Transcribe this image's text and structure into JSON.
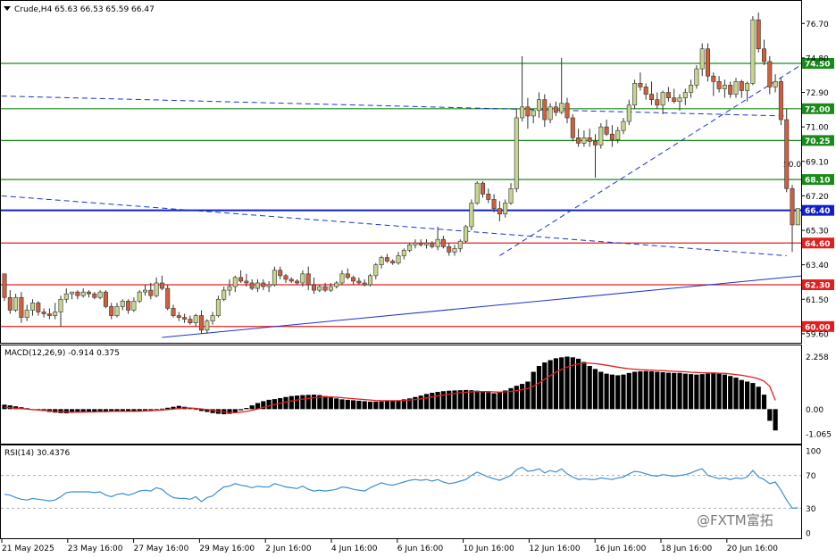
{
  "header": {
    "symbol_line": "Crude,H4  65.63 66.53 65.59 66.47",
    "macd_line": "MACD(12,26,9) -0.914 0.375",
    "rsi_line": "RSI(14) 30.4376"
  },
  "watermark": "@FXTM富拓",
  "colors": {
    "bull": "#c8d58c",
    "bear": "#d0603c",
    "resistance": "#1a8a1a",
    "support": "#e02020",
    "pivot": "#1020c8",
    "trend": "#1a33d0",
    "macd_signal": "#e02020",
    "rsi": "#3b8fd6"
  },
  "chart_data": [
    {
      "type": "candlestick",
      "name": "price",
      "y_ticks": [
        "76.70",
        "74.80",
        "72.90",
        "71.00",
        "69.10",
        "67.20",
        "65.30",
        "63.40",
        "61.50",
        "59.60"
      ],
      "ylim": [
        59.3,
        77.5
      ],
      "x_labels": [
        "21 May 2025",
        "23 May 16:00",
        "27 May 16:00",
        "29 May 16:00",
        "2 Jun 16:00",
        "4 Jun 16:00",
        "6 Jun 16:00",
        "10 Jun 16:00",
        "12 Jun 16:00",
        "16 Jun 16:00",
        "18 Jun 16:00",
        "20 Jun 16:00"
      ],
      "levels": [
        {
          "value": 74.5,
          "label": "74.50",
          "kind": "resistance"
        },
        {
          "value": 72.0,
          "label": "72.00",
          "kind": "resistance"
        },
        {
          "value": 70.25,
          "label": "70.25",
          "kind": "resistance"
        },
        {
          "value": 68.1,
          "label": "68.10",
          "kind": "resistance"
        },
        {
          "value": 66.4,
          "label": "66.40",
          "kind": "pivot"
        },
        {
          "value": 64.6,
          "label": "64.60",
          "kind": "support"
        },
        {
          "value": 62.3,
          "label": "62.30",
          "kind": "support"
        },
        {
          "value": 60.0,
          "label": "60.00",
          "kind": "support"
        }
      ],
      "fib_label": "50.0",
      "candles": [
        [
          62.9,
          62.6,
          61.4,
          61.6
        ],
        [
          61.6,
          62.0,
          60.7,
          60.9
        ],
        [
          60.9,
          61.8,
          60.8,
          61.6
        ],
        [
          61.6,
          61.9,
          60.2,
          60.5
        ],
        [
          60.5,
          61.2,
          60.3,
          60.9
        ],
        [
          60.9,
          61.5,
          60.6,
          61.3
        ],
        [
          61.3,
          61.4,
          60.6,
          60.8
        ],
        [
          60.8,
          61.0,
          60.5,
          60.7
        ],
        [
          60.7,
          61.0,
          60.4,
          60.6
        ],
        [
          60.6,
          61.3,
          60.4,
          60.8
        ],
        [
          60.8,
          61.7,
          60.0,
          61.5
        ],
        [
          61.5,
          62.1,
          61.3,
          61.8
        ],
        [
          61.8,
          61.9,
          61.5,
          61.9
        ],
        [
          61.9,
          62.0,
          61.5,
          61.7
        ],
        [
          61.7,
          62.1,
          61.6,
          61.9
        ],
        [
          61.9,
          62.0,
          61.6,
          61.8
        ],
        [
          61.8,
          61.9,
          61.5,
          61.6
        ],
        [
          61.6,
          62.0,
          61.5,
          61.9
        ],
        [
          61.9,
          62.0,
          61.0,
          61.1
        ],
        [
          61.1,
          61.3,
          60.4,
          60.6
        ],
        [
          60.6,
          61.3,
          60.5,
          61.1
        ],
        [
          61.1,
          61.5,
          60.9,
          61.4
        ],
        [
          61.4,
          61.5,
          60.7,
          60.9
        ],
        [
          60.9,
          61.6,
          60.8,
          61.4
        ],
        [
          61.4,
          62.0,
          61.3,
          61.9
        ],
        [
          61.9,
          62.3,
          61.7,
          62.0
        ],
        [
          62.0,
          62.4,
          61.5,
          61.7
        ],
        [
          61.7,
          62.7,
          61.6,
          62.4
        ],
        [
          62.4,
          62.8,
          62.0,
          62.1
        ],
        [
          62.1,
          62.3,
          60.9,
          61.0
        ],
        [
          61.0,
          61.2,
          60.5,
          60.6
        ],
        [
          60.6,
          60.8,
          60.3,
          60.5
        ],
        [
          60.5,
          60.7,
          60.2,
          60.4
        ],
        [
          60.4,
          60.6,
          60.1,
          60.2
        ],
        [
          60.2,
          60.7,
          60.0,
          60.6
        ],
        [
          60.6,
          60.9,
          59.6,
          59.8
        ],
        [
          59.8,
          60.4,
          59.6,
          60.3
        ],
        [
          60.3,
          60.8,
          60.1,
          60.6
        ],
        [
          60.6,
          61.7,
          60.5,
          61.5
        ],
        [
          61.5,
          62.2,
          61.4,
          62.0
        ],
        [
          62.0,
          62.6,
          61.7,
          62.2
        ],
        [
          62.2,
          62.8,
          61.9,
          62.7
        ],
        [
          62.7,
          63.1,
          62.4,
          62.5
        ],
        [
          62.5,
          62.9,
          62.2,
          62.4
        ],
        [
          62.4,
          62.6,
          62.0,
          62.1
        ],
        [
          62.1,
          62.6,
          61.9,
          62.4
        ],
        [
          62.4,
          62.6,
          62.0,
          62.2
        ],
        [
          62.2,
          62.5,
          61.9,
          62.3
        ],
        [
          62.3,
          63.3,
          62.2,
          63.1
        ],
        [
          63.1,
          63.3,
          62.6,
          62.8
        ],
        [
          62.8,
          62.9,
          62.4,
          62.6
        ],
        [
          62.6,
          62.7,
          62.4,
          62.5
        ],
        [
          62.5,
          62.6,
          62.3,
          62.4
        ],
        [
          62.4,
          63.1,
          62.2,
          62.9
        ],
        [
          62.9,
          63.3,
          62.0,
          62.3
        ],
        [
          62.3,
          62.7,
          61.8,
          62.0
        ],
        [
          62.0,
          62.3,
          61.9,
          62.2
        ],
        [
          62.2,
          62.4,
          61.9,
          62.0
        ],
        [
          62.0,
          62.4,
          61.9,
          62.2
        ],
        [
          62.2,
          62.5,
          62.1,
          62.4
        ],
        [
          62.4,
          63.1,
          62.3,
          62.9
        ],
        [
          62.9,
          63.2,
          62.6,
          62.7
        ],
        [
          62.7,
          62.8,
          62.3,
          62.5
        ],
        [
          62.5,
          62.7,
          62.3,
          62.4
        ],
        [
          62.4,
          62.6,
          62.2,
          62.3
        ],
        [
          62.3,
          62.9,
          62.2,
          62.8
        ],
        [
          62.8,
          63.5,
          62.6,
          63.4
        ],
        [
          63.4,
          63.9,
          63.2,
          63.8
        ],
        [
          63.8,
          64.0,
          63.5,
          63.6
        ],
        [
          63.6,
          63.7,
          63.4,
          63.5
        ],
        [
          63.5,
          64.1,
          63.4,
          63.9
        ],
        [
          63.9,
          64.3,
          63.7,
          64.2
        ],
        [
          64.2,
          64.6,
          64.1,
          64.5
        ],
        [
          64.5,
          64.8,
          64.3,
          64.6
        ],
        [
          64.6,
          64.8,
          64.4,
          64.5
        ],
        [
          64.5,
          64.8,
          64.3,
          64.6
        ],
        [
          64.6,
          64.7,
          64.3,
          64.4
        ],
        [
          64.4,
          65.5,
          64.2,
          64.8
        ],
        [
          64.8,
          65.0,
          64.3,
          64.4
        ],
        [
          64.4,
          64.6,
          63.9,
          64.1
        ],
        [
          64.1,
          64.5,
          63.9,
          64.3
        ],
        [
          64.3,
          64.8,
          64.1,
          64.7
        ],
        [
          64.7,
          65.6,
          64.6,
          65.5
        ],
        [
          65.5,
          67.0,
          65.3,
          66.8
        ],
        [
          66.8,
          68.0,
          66.7,
          67.9
        ],
        [
          67.9,
          68.0,
          67.1,
          67.3
        ],
        [
          67.3,
          67.6,
          66.8,
          67.0
        ],
        [
          67.0,
          67.3,
          66.3,
          66.5
        ],
        [
          66.5,
          66.9,
          65.8,
          66.2
        ],
        [
          66.2,
          67.0,
          66.0,
          66.8
        ],
        [
          66.8,
          67.9,
          66.7,
          67.6
        ],
        [
          67.6,
          72.0,
          67.4,
          71.5
        ],
        [
          71.5,
          74.9,
          71.3,
          72.1
        ],
        [
          72.1,
          72.6,
          70.9,
          71.6
        ],
        [
          71.6,
          72.0,
          71.2,
          71.9
        ],
        [
          71.9,
          72.9,
          71.5,
          72.5
        ],
        [
          72.5,
          72.8,
          71.0,
          71.4
        ],
        [
          71.4,
          72.3,
          71.2,
          72.1
        ],
        [
          72.1,
          72.4,
          71.6,
          71.8
        ],
        [
          71.8,
          74.8,
          71.7,
          72.3
        ],
        [
          72.3,
          72.6,
          71.2,
          71.5
        ],
        [
          71.5,
          71.7,
          70.2,
          70.4
        ],
        [
          70.4,
          70.9,
          69.9,
          70.1
        ],
        [
          70.1,
          70.8,
          69.9,
          70.4
        ],
        [
          70.4,
          70.9,
          69.9,
          70.2
        ],
        [
          70.2,
          70.6,
          68.2,
          70.0
        ],
        [
          70.0,
          71.2,
          69.8,
          71.0
        ],
        [
          71.0,
          71.4,
          70.5,
          70.6
        ],
        [
          70.6,
          71.1,
          69.9,
          70.3
        ],
        [
          70.3,
          71.0,
          70.1,
          70.8
        ],
        [
          70.8,
          71.5,
          70.6,
          71.3
        ],
        [
          71.3,
          72.5,
          71.1,
          72.2
        ],
        [
          72.2,
          73.6,
          72.0,
          73.4
        ],
        [
          73.4,
          74.0,
          73.0,
          73.2
        ],
        [
          73.2,
          73.4,
          72.5,
          72.8
        ],
        [
          72.8,
          73.5,
          72.2,
          72.5
        ],
        [
          72.5,
          72.9,
          72.0,
          72.2
        ],
        [
          72.2,
          73.0,
          71.7,
          72.9
        ],
        [
          72.9,
          73.2,
          72.4,
          72.6
        ],
        [
          72.6,
          73.1,
          72.3,
          72.4
        ],
        [
          72.4,
          72.8,
          71.9,
          72.6
        ],
        [
          72.6,
          73.1,
          72.2,
          72.9
        ],
        [
          72.9,
          73.6,
          72.6,
          73.3
        ],
        [
          73.3,
          74.4,
          73.1,
          74.2
        ],
        [
          74.2,
          75.6,
          73.8,
          75.3
        ],
        [
          75.3,
          75.6,
          73.5,
          73.8
        ],
        [
          73.8,
          74.0,
          72.7,
          73.5
        ],
        [
          73.5,
          73.8,
          72.9,
          73.1
        ],
        [
          73.1,
          73.6,
          72.6,
          73.3
        ],
        [
          73.3,
          73.5,
          72.6,
          72.8
        ],
        [
          72.8,
          73.7,
          72.6,
          73.5
        ],
        [
          73.5,
          73.6,
          72.6,
          73.0
        ],
        [
          73.0,
          73.5,
          72.4,
          73.4
        ],
        [
          73.4,
          77.1,
          73.3,
          76.9
        ],
        [
          76.9,
          77.3,
          75.1,
          75.3
        ],
        [
          75.3,
          75.8,
          74.4,
          74.6
        ],
        [
          74.6,
          74.9,
          72.8,
          73.2
        ],
        [
          73.2,
          73.9,
          72.9,
          73.5
        ],
        [
          73.5,
          73.7,
          71.1,
          71.4
        ],
        [
          71.4,
          72.0,
          67.4,
          67.6
        ],
        [
          67.6,
          67.8,
          64.1,
          65.6
        ],
        [
          65.6,
          66.5,
          65.6,
          66.5
        ]
      ]
    },
    {
      "type": "bar",
      "name": "MACD(12,26,9)",
      "y_ticks": [
        "2.258",
        "0.00",
        "-1.065"
      ],
      "ylim": [
        -1.25,
        2.5
      ],
      "histogram": [
        0.19,
        0.16,
        0.12,
        0.08,
        0.04,
        0.0,
        -0.04,
        -0.08,
        -0.12,
        -0.15,
        -0.17,
        -0.18,
        -0.16,
        -0.14,
        -0.12,
        -0.11,
        -0.1,
        -0.09,
        -0.09,
        -0.1,
        -0.12,
        -0.12,
        -0.11,
        -0.1,
        -0.08,
        -0.06,
        -0.04,
        -0.02,
        0.02,
        0.06,
        0.1,
        0.14,
        0.1,
        0.03,
        -0.03,
        -0.08,
        -0.12,
        -0.17,
        -0.2,
        -0.22,
        -0.2,
        -0.14,
        -0.05,
        0.05,
        0.16,
        0.26,
        0.34,
        0.4,
        0.43,
        0.47,
        0.52,
        0.56,
        0.58,
        0.6,
        0.61,
        0.62,
        0.6,
        0.56,
        0.5,
        0.46,
        0.42,
        0.4,
        0.38,
        0.36,
        0.34,
        0.32,
        0.32,
        0.33,
        0.34,
        0.36,
        0.38,
        0.42,
        0.46,
        0.52,
        0.58,
        0.65,
        0.7,
        0.74,
        0.77,
        0.79,
        0.8,
        0.81,
        0.82,
        0.81,
        0.79,
        0.76,
        0.72,
        0.68,
        0.72,
        0.8,
        0.9,
        1.0,
        1.08,
        1.18,
        1.6,
        1.85,
        2.0,
        2.1,
        2.18,
        2.22,
        2.25,
        2.22,
        2.16,
        2.02,
        1.85,
        1.72,
        1.6,
        1.52,
        1.48,
        1.45,
        1.48,
        1.55,
        1.6,
        1.62,
        1.63,
        1.62,
        1.6,
        1.58,
        1.56,
        1.55,
        1.55,
        1.52,
        1.5,
        1.48,
        1.5,
        1.52,
        1.55,
        1.52,
        1.48,
        1.42,
        1.35,
        1.25,
        1.18,
        1.12,
        0.96,
        0.62,
        -0.5,
        -0.914
      ],
      "signal": [
        0.09,
        0.06,
        0.04,
        0.02,
        0.0,
        -0.02,
        -0.04,
        -0.06,
        -0.08,
        -0.1,
        -0.11,
        -0.12,
        -0.13,
        -0.13,
        -0.13,
        -0.12,
        -0.12,
        -0.11,
        -0.11,
        -0.1,
        -0.1,
        -0.1,
        -0.1,
        -0.1,
        -0.09,
        -0.08,
        -0.07,
        -0.06,
        -0.04,
        -0.02,
        0.0,
        0.03,
        0.05,
        0.05,
        0.03,
        0.01,
        -0.02,
        -0.05,
        -0.09,
        -0.12,
        -0.14,
        -0.15,
        -0.13,
        -0.1,
        -0.05,
        0.01,
        0.08,
        0.14,
        0.2,
        0.25,
        0.3,
        0.35,
        0.39,
        0.43,
        0.46,
        0.49,
        0.51,
        0.52,
        0.52,
        0.51,
        0.49,
        0.47,
        0.45,
        0.43,
        0.41,
        0.39,
        0.37,
        0.36,
        0.36,
        0.36,
        0.36,
        0.37,
        0.39,
        0.41,
        0.44,
        0.48,
        0.52,
        0.56,
        0.6,
        0.64,
        0.67,
        0.7,
        0.72,
        0.74,
        0.75,
        0.75,
        0.75,
        0.74,
        0.73,
        0.74,
        0.76,
        0.79,
        0.83,
        0.88,
        0.98,
        1.12,
        1.28,
        1.44,
        1.58,
        1.7,
        1.8,
        1.88,
        1.94,
        1.97,
        1.97,
        1.95,
        1.92,
        1.88,
        1.84,
        1.8,
        1.76,
        1.73,
        1.71,
        1.69,
        1.68,
        1.67,
        1.66,
        1.65,
        1.63,
        1.62,
        1.61,
        1.6,
        1.58,
        1.57,
        1.56,
        1.55,
        1.55,
        1.54,
        1.53,
        1.51,
        1.48,
        1.45,
        1.41,
        1.36,
        1.3,
        1.2,
        0.98,
        0.375
      ]
    },
    {
      "type": "line",
      "name": "RSI(14)",
      "y_ticks": [
        "100",
        "70",
        "30",
        "0"
      ],
      "ylim": [
        0,
        100
      ],
      "guides": [
        70,
        30
      ],
      "values": [
        47,
        46,
        43,
        41,
        40,
        42,
        41,
        40,
        39,
        40,
        44,
        49,
        50,
        50,
        50,
        50,
        49,
        50,
        46,
        44,
        47,
        48,
        46,
        48,
        51,
        52,
        51,
        55,
        53,
        47,
        43,
        42,
        42,
        41,
        44,
        38,
        43,
        45,
        51,
        56,
        57,
        60,
        58,
        57,
        55,
        57,
        56,
        56,
        60,
        58,
        56,
        55,
        54,
        57,
        53,
        51,
        52,
        51,
        52,
        53,
        56,
        55,
        53,
        52,
        51,
        55,
        58,
        61,
        59,
        58,
        60,
        62,
        64,
        65,
        64,
        65,
        63,
        65,
        62,
        60,
        61,
        63,
        65,
        70,
        74,
        71,
        68,
        66,
        64,
        67,
        70,
        77,
        80,
        75,
        76,
        78,
        73,
        76,
        74,
        78,
        72,
        68,
        65,
        66,
        65,
        65,
        67,
        66,
        65,
        67,
        68,
        72,
        75,
        74,
        72,
        70,
        69,
        71,
        70,
        69,
        70,
        71,
        73,
        76,
        78,
        70,
        68,
        66,
        67,
        65,
        67,
        66,
        68,
        76,
        68,
        65,
        60,
        62,
        52,
        40,
        30,
        30.44
      ]
    }
  ]
}
